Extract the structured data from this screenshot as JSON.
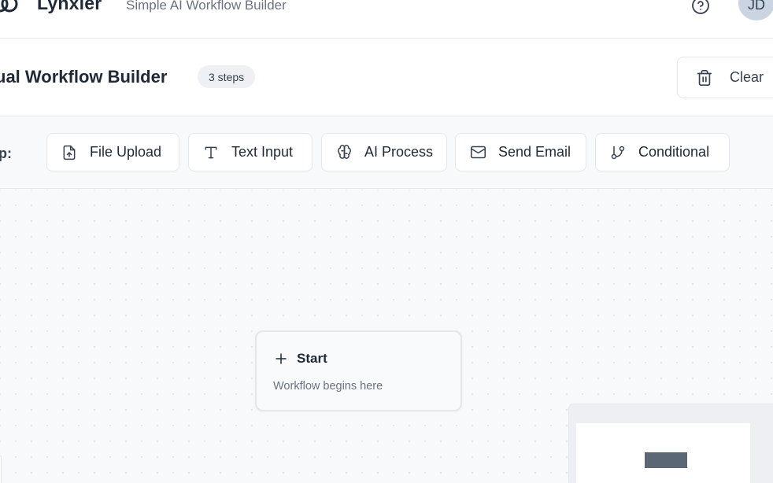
{
  "header": {
    "brand": "Lynxier",
    "tagline": "Simple AI Workflow Builder",
    "avatar_initials": "JD",
    "icons": {
      "logo": "logo-mark-icon",
      "help": "help-circle-icon"
    }
  },
  "title_bar": {
    "title": "ual Workflow Builder",
    "steps_badge": "3 steps",
    "clear_label": "Clear"
  },
  "toolbar": {
    "label": "Step:",
    "buttons": [
      {
        "label": "File Upload",
        "icon": "file-upload-icon"
      },
      {
        "label": "Text Input",
        "icon": "text-type-icon"
      },
      {
        "label": "AI Process",
        "icon": "brain-icon"
      },
      {
        "label": "Send Email",
        "icon": "mail-icon"
      },
      {
        "label": "Conditional",
        "icon": "git-branch-icon"
      }
    ]
  },
  "canvas": {
    "start_node": {
      "title": "Start",
      "description": "Workflow begins here"
    }
  },
  "colors": {
    "text": "#1f2937",
    "muted": "#6b7280",
    "border": "#e5e7eb",
    "canvas_bg": "#f8f9fb",
    "avatar_bg": "#cbd5e1",
    "minimap_node": "#5b6775"
  }
}
